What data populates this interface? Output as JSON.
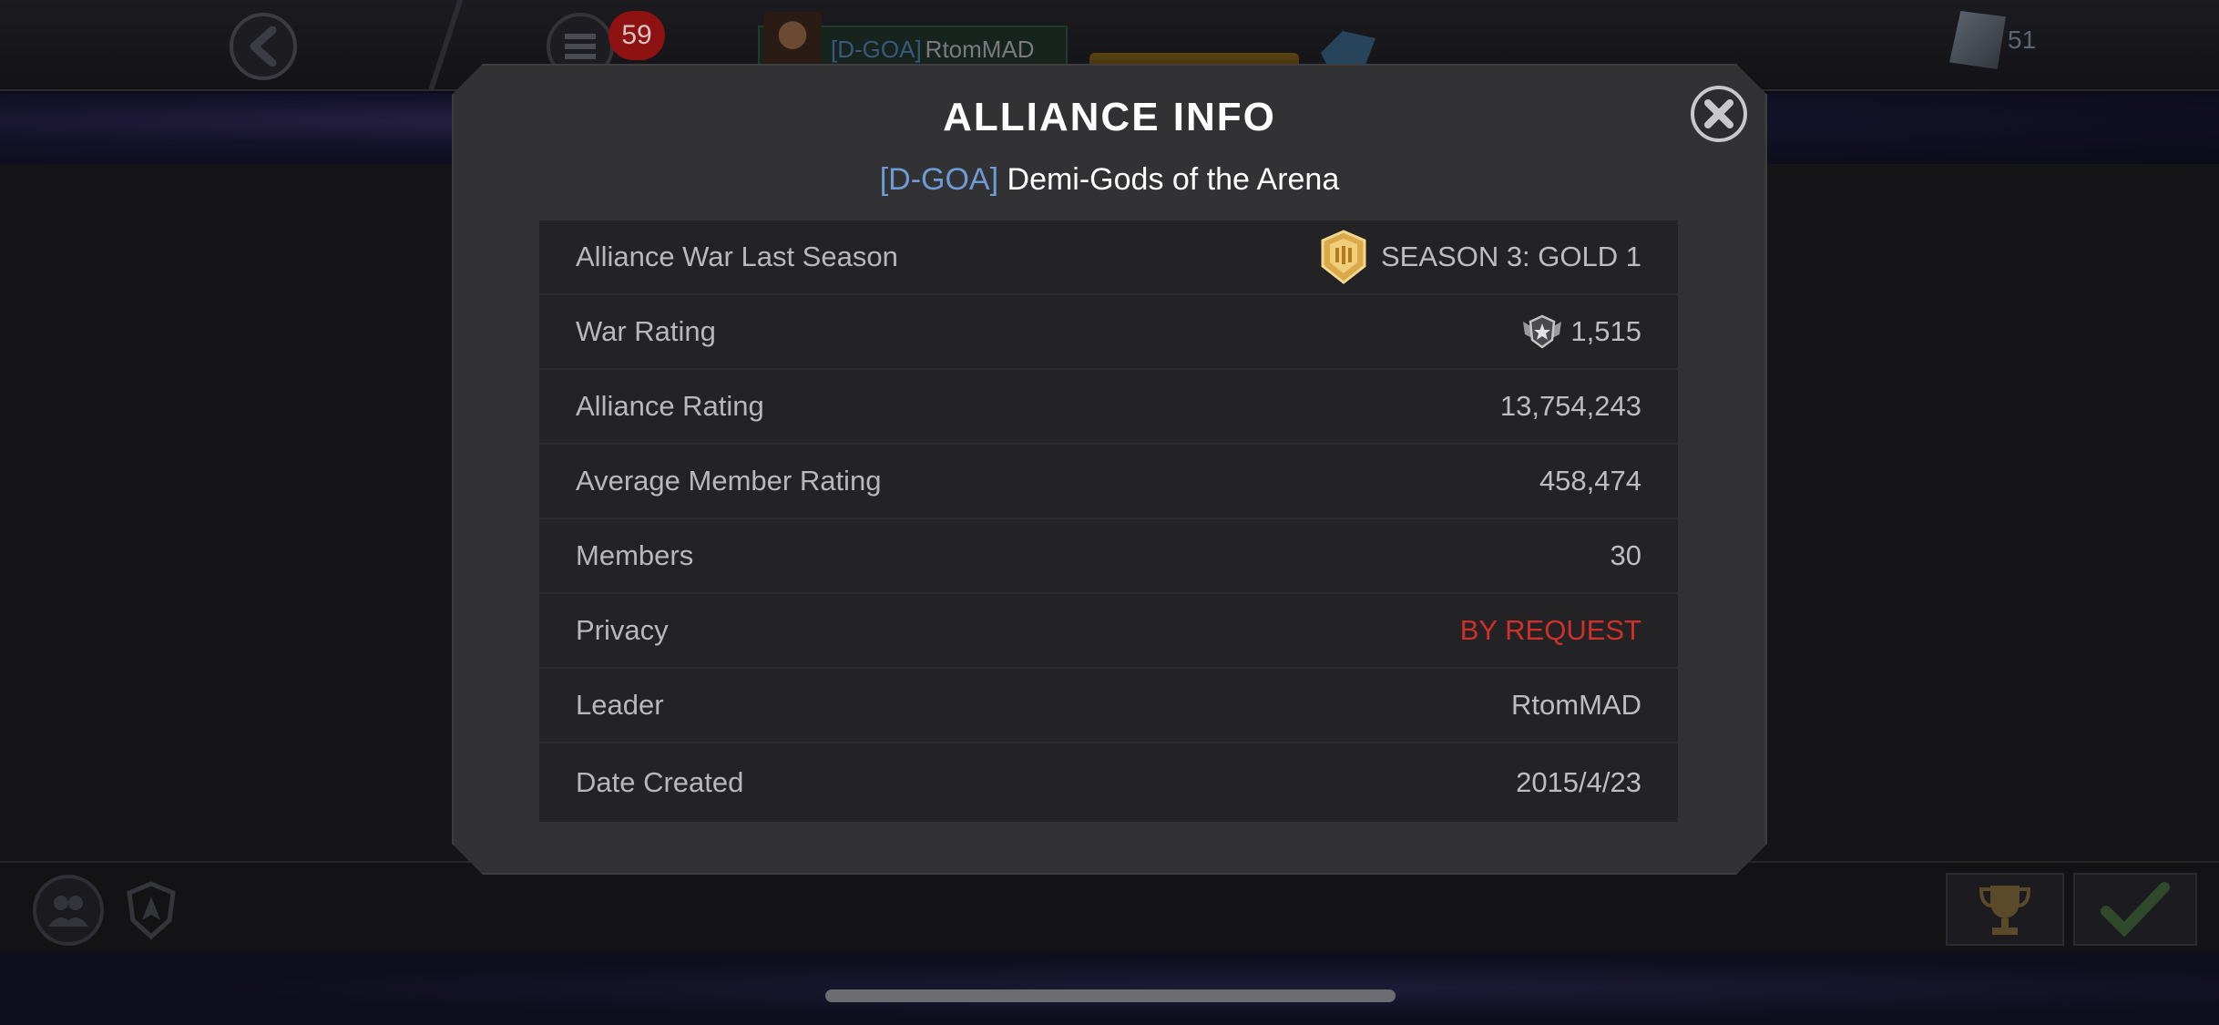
{
  "background": {
    "notification_count": "59",
    "player_tag": "[D-GOA]",
    "player_name": "RtomMAD",
    "shard_count": "51"
  },
  "modal": {
    "title": "ALLIANCE INFO",
    "alliance_tag": "[D-GOA]",
    "alliance_name": "Demi-Gods of the Arena",
    "rows": [
      {
        "label": "Alliance War Last Season",
        "value": "SEASON 3: GOLD 1",
        "icon": "gold-tier-badge-icon"
      },
      {
        "label": "War Rating",
        "value": "1,515",
        "icon": "war-rating-icon"
      },
      {
        "label": "Alliance Rating",
        "value": "13,754,243"
      },
      {
        "label": "Average Member Rating",
        "value": "458,474"
      },
      {
        "label": "Members",
        "value": "30"
      },
      {
        "label": "Privacy",
        "value": "BY REQUEST",
        "color": "#d0302b"
      },
      {
        "label": "Leader",
        "value": "RtomMAD"
      },
      {
        "label": "Date Created",
        "value": "2015/4/23"
      }
    ]
  },
  "colors": {
    "tag_blue": "#6e9bd6",
    "privacy_red": "#d0302b",
    "modal_bg": "#323234",
    "table_bg": "#232325"
  }
}
